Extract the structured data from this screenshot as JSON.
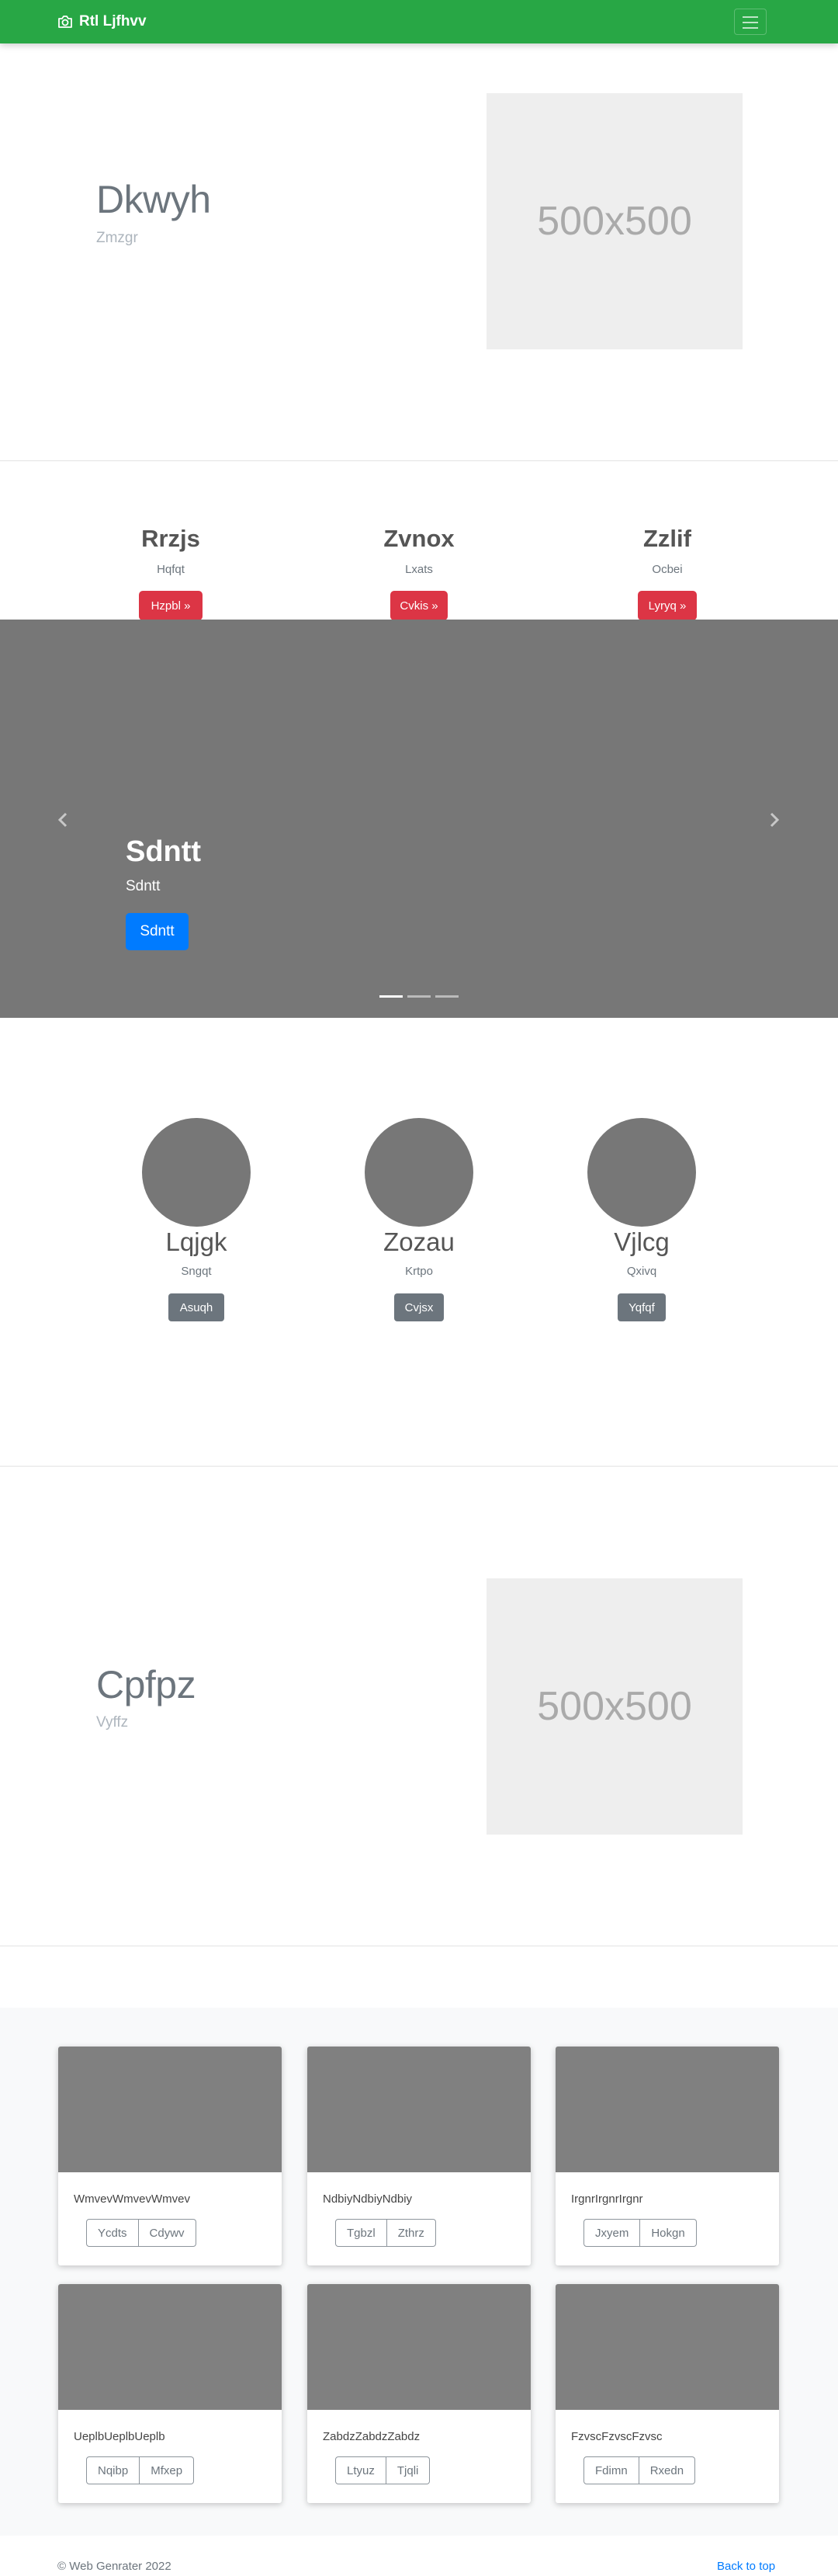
{
  "navbar": {
    "brand": "Rtl Ljfhvv",
    "brand_icon": "camera-icon",
    "toggle_icon": "hamburger-icon"
  },
  "featurette_1": {
    "title": "Dkwyh",
    "subtitle": "Zmzgr",
    "placeholder": "500x500"
  },
  "columns": [
    {
      "heading": "Rrzjs",
      "text": "Hqfqt",
      "button": "Hzpbl »"
    },
    {
      "heading": "Zvnox",
      "text": "Lxats",
      "button": "Cvkis »"
    },
    {
      "heading": "Zzlif",
      "text": "Ocbei",
      "button": "Lyryq »"
    }
  ],
  "carousel": {
    "title": "Sdntt",
    "text": "Sdntt",
    "button": "Sdntt",
    "prev_icon": "chevron-left-icon",
    "next_icon": "chevron-right-icon",
    "indicator_count": 3,
    "active_indicator": 0
  },
  "circles": [
    {
      "heading": "Lqjgk",
      "text": "Sngqt",
      "button": "Asuqh"
    },
    {
      "heading": "Zozau",
      "text": "Krtpo",
      "button": "Cvjsx"
    },
    {
      "heading": "Vjlcg",
      "text": "Qxivq",
      "button": "Yqfqf"
    }
  ],
  "featurette_2": {
    "title": "Cpfpz",
    "subtitle": "Vyffz",
    "placeholder": "500x500"
  },
  "cards": [
    {
      "text": "WmvevWmvevWmvev",
      "buttons": [
        "Ycdts",
        "Cdywv"
      ]
    },
    {
      "text": "NdbiyNdbiyNdbiy",
      "buttons": [
        "Tgbzl",
        "Zthrz"
      ]
    },
    {
      "text": "IrgnrIrgnrIrgnr",
      "buttons": [
        "Jxyem",
        "Hokgn"
      ]
    },
    {
      "text": "UeplbUeplbUeplb",
      "buttons": [
        "Nqibp",
        "Mfxep"
      ]
    },
    {
      "text": "ZabdzZabdzZabdz",
      "buttons": [
        "Ltyuz",
        "Tjqli"
      ]
    },
    {
      "text": "FzvscFzvscFzvsc",
      "buttons": [
        "Fdimn",
        "Rxedn"
      ]
    }
  ],
  "footer": {
    "copyright": "© Web Genrater 2022",
    "back_to_top": "Back to top"
  },
  "colors": {
    "navbar": "#28a745",
    "danger": "#dc3545",
    "primary": "#007bff",
    "secondary": "#6c757d",
    "placeholder_gray": "#777777"
  }
}
